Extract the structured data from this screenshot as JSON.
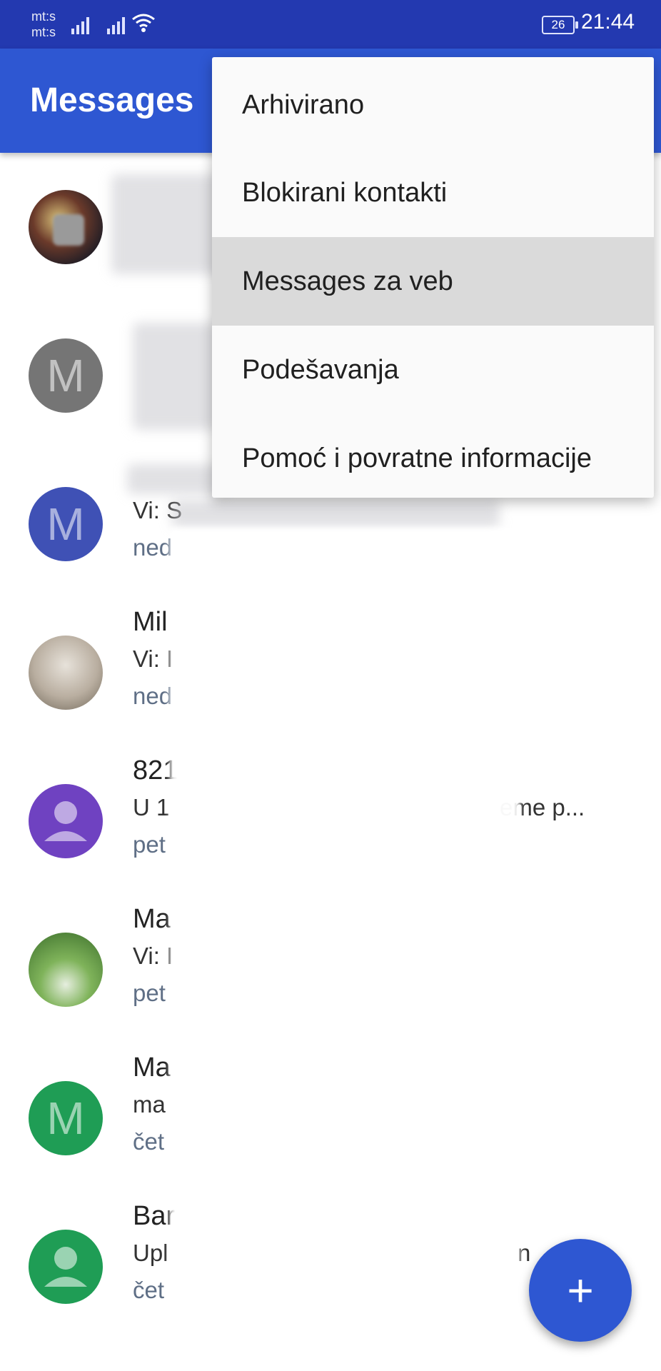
{
  "status_bar": {
    "carrier1": "mt:s",
    "carrier2": "mt:s",
    "battery": "26",
    "time": "21:44",
    "icons": [
      "signal-icon",
      "signal-icon",
      "wifi-icon",
      "battery-icon"
    ]
  },
  "app_bar": {
    "title": "Messages"
  },
  "overflow_menu": {
    "items": [
      {
        "label": "Arhivirano"
      },
      {
        "label": "Blokirani kontakti"
      },
      {
        "label": "Messages za veb",
        "highlighted": true
      },
      {
        "label": "Podešavanja"
      },
      {
        "label": "Pomoć i povratne informacije"
      }
    ]
  },
  "conversations": [
    {
      "avatar": "photo",
      "avatar_color": "#444444",
      "name": "",
      "snippet": "",
      "date": ""
    },
    {
      "avatar": "letter",
      "avatar_letter": "M",
      "avatar_color": "#757575",
      "name": "",
      "snippet": "",
      "date": ""
    },
    {
      "avatar": "letter",
      "avatar_letter": "M",
      "avatar_color": "#3f51b5",
      "name": "",
      "snippet": "Vi: S",
      "date": "ned"
    },
    {
      "avatar": "photo",
      "avatar_color": "#b9aea0",
      "name": "Mil",
      "snippet": "Vi: I",
      "date": "ned"
    },
    {
      "avatar": "person",
      "avatar_color": "#6f42c1",
      "name": "821",
      "snippet": "U 1",
      "snippet_tail": "eme p...",
      "date": "pet"
    },
    {
      "avatar": "photo",
      "avatar_color": "#4f8a3a",
      "name": "Ma",
      "snippet": "Vi: I",
      "date": "pet"
    },
    {
      "avatar": "letter",
      "avatar_letter": "M",
      "avatar_color": "#1f9d55",
      "name": "Ma",
      "snippet": "ma",
      "date": "čet"
    },
    {
      "avatar": "person",
      "avatar_color": "#1f9d55",
      "name": "Bar",
      "snippet": "Upl",
      "snippet_tail": "n",
      "date": "čet"
    }
  ],
  "fab": {
    "label": "+",
    "icon": "plus-icon",
    "color": "#2e57d2"
  }
}
